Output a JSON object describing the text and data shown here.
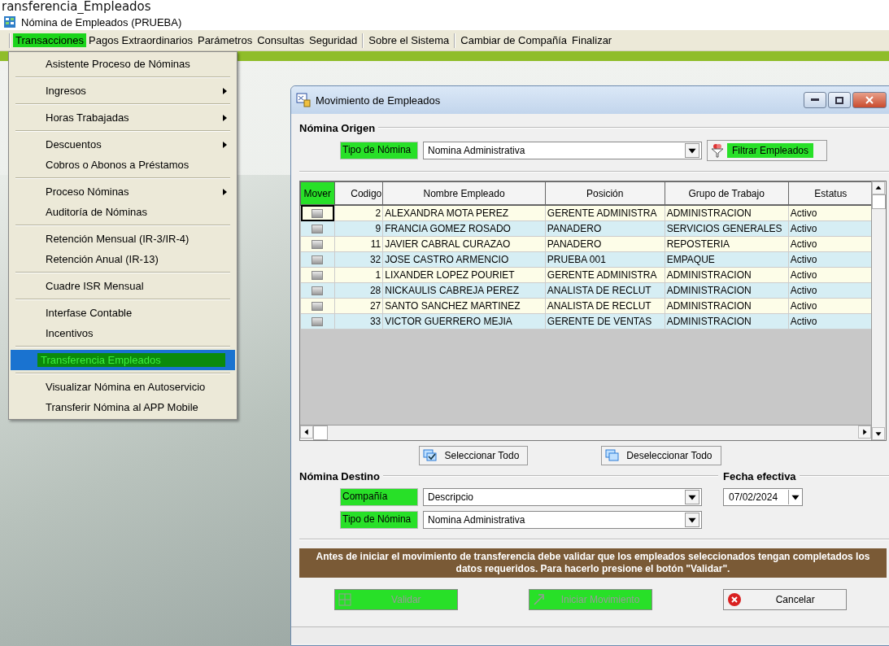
{
  "page_heading": "ransferencia_Empleados",
  "app": {
    "title": "Nómina de Empleados (PRUEBA)"
  },
  "menubar": [
    [
      {
        "label": "Transacciones",
        "selected": true
      },
      {
        "label": "Pagos Extraordinarios",
        "selected": false
      },
      {
        "label": "Parámetros",
        "selected": false
      },
      {
        "label": "Consultas",
        "selected": false
      },
      {
        "label": "Seguridad",
        "selected": false
      }
    ],
    [
      {
        "label": "Sobre el Sistema",
        "selected": false
      }
    ],
    [
      {
        "label": "Cambiar de Compañía",
        "selected": false
      },
      {
        "label": "Finalizar",
        "selected": false
      }
    ]
  ],
  "menu": [
    [
      {
        "label": "Asistente Proceso de Nóminas",
        "has_submenu": false,
        "selected": false
      }
    ],
    [
      {
        "label": "Ingresos",
        "has_submenu": true,
        "selected": false
      }
    ],
    [
      {
        "label": "Horas Trabajadas",
        "has_submenu": true,
        "selected": false
      }
    ],
    [
      {
        "label": "Descuentos",
        "has_submenu": true,
        "selected": false
      },
      {
        "label": "Cobros o Abonos a Préstamos",
        "has_submenu": false,
        "selected": false
      }
    ],
    [
      {
        "label": "Proceso Nóminas",
        "has_submenu": true,
        "selected": false
      },
      {
        "label": "Auditoría de Nóminas",
        "has_submenu": false,
        "selected": false
      }
    ],
    [
      {
        "label": "Retención Mensual  (IR-3/IR-4)",
        "has_submenu": false,
        "selected": false
      },
      {
        "label": "Retención Anual  (IR-13)",
        "has_submenu": false,
        "selected": false
      }
    ],
    [
      {
        "label": "Cuadre ISR Mensual",
        "has_submenu": false,
        "selected": false
      }
    ],
    [
      {
        "label": "Interfase Contable",
        "has_submenu": false,
        "selected": false
      },
      {
        "label": "Incentivos",
        "has_submenu": false,
        "selected": false
      }
    ],
    [
      {
        "label": "Transferencia Empleados",
        "has_submenu": false,
        "selected": true
      }
    ],
    [
      {
        "label": "Visualizar Nómina en Autoservicio",
        "has_submenu": false,
        "selected": false
      },
      {
        "label": "Transferir Nómina al APP Mobile",
        "has_submenu": false,
        "selected": false
      }
    ]
  ],
  "dialog": {
    "title": "Movimiento de Empleados",
    "origin": {
      "heading": "Nómina Origen",
      "payroll_type": {
        "label": "Tipo de Nómina",
        "highlighted": true,
        "value": "Nomina Administrativa"
      },
      "filter_button": {
        "label": "Filtrar Empleados",
        "highlighted": true
      }
    },
    "table": {
      "columns": [
        {
          "label": "Mover",
          "highlighted": true
        },
        {
          "label": "Codigo",
          "highlighted": false
        },
        {
          "label": "Nombre Empleado",
          "highlighted": false
        },
        {
          "label": "Posición",
          "highlighted": false
        },
        {
          "label": "Grupo de Trabajo",
          "highlighted": false
        },
        {
          "label": "Estatus",
          "highlighted": false
        }
      ],
      "rows": [
        {
          "checked": false,
          "codigo": "2",
          "nombre": "ALEXANDRA MOTA PEREZ",
          "posicion": "GERENTE ADMINISTRA",
          "grupo": "ADMINISTRACION",
          "estatus": "Activo"
        },
        {
          "checked": false,
          "codigo": "9",
          "nombre": "FRANCIA GOMEZ ROSADO",
          "posicion": "PANADERO",
          "grupo": "SERVICIOS GENERALES",
          "estatus": "Activo"
        },
        {
          "checked": false,
          "codigo": "11",
          "nombre": "JAVIER CABRAL CURAZAO",
          "posicion": "PANADERO",
          "grupo": "REPOSTERIA",
          "estatus": "Activo"
        },
        {
          "checked": false,
          "codigo": "32",
          "nombre": "JOSE CASTRO ARMENCIO",
          "posicion": "PRUEBA 001",
          "grupo": "EMPAQUE",
          "estatus": "Activo"
        },
        {
          "checked": false,
          "codigo": "1",
          "nombre": "LIXANDER LOPEZ POURIET",
          "posicion": "GERENTE ADMINISTRA",
          "grupo": "ADMINISTRACION",
          "estatus": "Activo"
        },
        {
          "checked": false,
          "codigo": "28",
          "nombre": "NICKAULIS CABREJA PEREZ",
          "posicion": "ANALISTA DE RECLUT",
          "grupo": "ADMINISTRACION",
          "estatus": "Activo"
        },
        {
          "checked": false,
          "codigo": "27",
          "nombre": "SANTO SANCHEZ MARTINEZ",
          "posicion": "ANALISTA DE RECLUT",
          "grupo": "ADMINISTRACION",
          "estatus": "Activo"
        },
        {
          "checked": false,
          "codigo": "33",
          "nombre": "VICTOR GUERRERO MEJIA",
          "posicion": "GERENTE DE VENTAS",
          "grupo": "ADMINISTRACION",
          "estatus": "Activo"
        }
      ]
    },
    "select_all": "Seleccionar Todo",
    "deselect_all": "Deseleccionar Todo",
    "destination": {
      "heading": "Nómina Destino",
      "company": {
        "label": "Compañía",
        "highlighted": true,
        "value": "Descripcio"
      },
      "payroll_type": {
        "label": "Tipo de Nómina",
        "highlighted": true,
        "value": "Nomina Administrativa"
      }
    },
    "effective_date": {
      "heading": "Fecha efectiva",
      "value": "07/02/2024"
    },
    "notice": "Antes de iniciar el movimiento de transferencia debe validar que los empleados seleccionados tengan completados los datos requeridos. Para hacerlo presione el botón \"Validar\".",
    "buttons": [
      {
        "kind": "validate",
        "label": "Validar",
        "disabled": true,
        "highlighted": true
      },
      {
        "kind": "start",
        "label": "Iniciar Movimiento",
        "disabled": true,
        "highlighted": true
      },
      {
        "kind": "cancel",
        "label": "Cancelar",
        "disabled": false,
        "highlighted": false
      }
    ]
  }
}
